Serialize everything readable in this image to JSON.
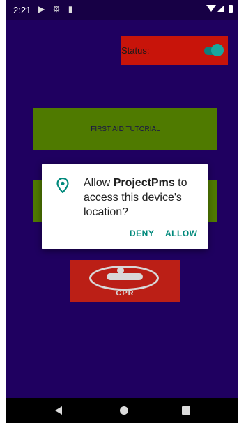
{
  "status_bar": {
    "time": "2:21",
    "left_icons": [
      "play-icon",
      "gear-icon",
      "sd-card-icon"
    ],
    "right_icons": [
      "wifi-icon",
      "signal-icon",
      "battery-icon"
    ]
  },
  "status_card": {
    "label": "Status:",
    "toggle_on": true,
    "color": "#c8140a"
  },
  "buttons": {
    "tutorial_label": "FIRST AID TUTORIAL",
    "cpr_label": "CPR"
  },
  "dialog": {
    "message_prefix": "Allow ",
    "app_name": "ProjectPms",
    "message_suffix": " to access this device's location?",
    "deny_label": "DENY",
    "allow_label": "ALLOW",
    "icon": "location-pin-icon",
    "accent_color": "#00897b"
  },
  "nav_bar": {
    "buttons": [
      "back-icon",
      "home-icon",
      "recents-icon"
    ]
  },
  "colors": {
    "background": "#1f0060",
    "tutorial_button": "#4f7a00",
    "cpr_button": "#bb1f16"
  }
}
